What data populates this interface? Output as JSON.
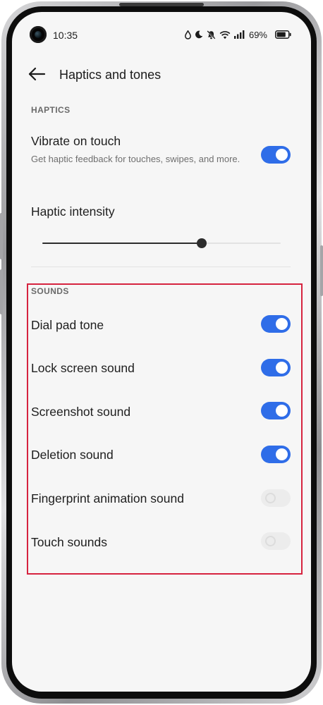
{
  "status_bar": {
    "time": "10:35",
    "battery_percent": "69%",
    "icons": [
      "water-drop-icon",
      "moon-icon",
      "bell-off-icon",
      "wifi-icon",
      "signal-icon",
      "battery-icon"
    ]
  },
  "header": {
    "back_icon": "arrow-left-icon",
    "title": "Haptics and tones"
  },
  "haptics": {
    "section_label": "HAPTICS",
    "vibrate_on_touch": {
      "title": "Vibrate on touch",
      "description": "Get haptic feedback for touches, swipes, and more.",
      "enabled": true
    },
    "haptic_intensity": {
      "title": "Haptic intensity",
      "value_fraction": 0.67
    }
  },
  "sounds": {
    "section_label": "SOUNDS",
    "items": [
      {
        "label": "Dial pad tone",
        "enabled": true,
        "disabled": false
      },
      {
        "label": "Lock screen sound",
        "enabled": true,
        "disabled": false
      },
      {
        "label": "Screenshot sound",
        "enabled": true,
        "disabled": false
      },
      {
        "label": "Deletion sound",
        "enabled": true,
        "disabled": false
      },
      {
        "label": "Fingerprint animation sound",
        "enabled": false,
        "disabled": true
      },
      {
        "label": "Touch sounds",
        "enabled": false,
        "disabled": true
      }
    ]
  },
  "colors": {
    "accent": "#2f6de8",
    "highlight_border": "#d6233f"
  }
}
